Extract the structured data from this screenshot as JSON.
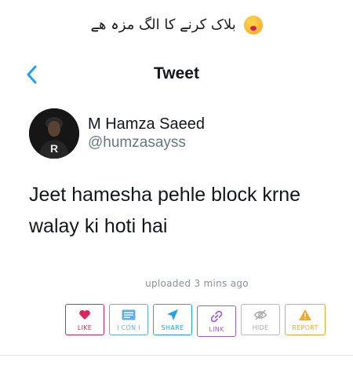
{
  "caption": {
    "text": "بلاک کرنے کا الگ مزہ ھے",
    "emoji": "kissing-face-emoji"
  },
  "header": {
    "title": "Tweet",
    "back_icon": "chevron-left-icon"
  },
  "user": {
    "name": "M Hamza Saeed",
    "handle": "@humzasayss"
  },
  "tweet": {
    "line1": "Jeet hamesha pehle block krne",
    "line2": "walay ki hoti hai"
  },
  "meta": {
    "uploaded": "uploaded 3 mins ago"
  },
  "actions": {
    "like": "LIKE",
    "icon": "I CON I",
    "share": "SHARE",
    "link": "LINK",
    "hide": "HIDE",
    "report": "REPORT"
  },
  "colors": {
    "twitter_blue": "#1da1f2",
    "like": "#e0245e",
    "icon": "#5ab0e6",
    "share": "#1da1f2",
    "link": "#a05ad6",
    "hide": "#a8a8a8",
    "report": "#f5a623"
  }
}
